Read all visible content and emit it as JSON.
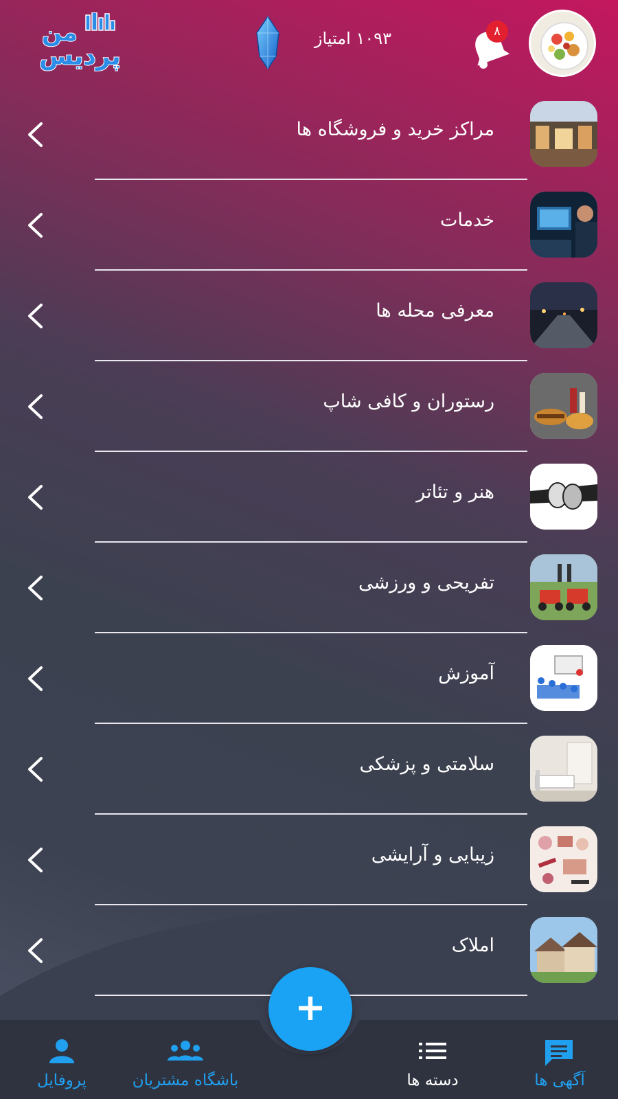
{
  "header": {
    "points_text": "۱۰۹۳ امتیاز",
    "notification_count": "۸",
    "logo_line1": "من",
    "logo_line2": "پردیس"
  },
  "categories": [
    {
      "label": "مراکز خرید و فروشگاه ها",
      "icon": "shopping-mall-thumbnail"
    },
    {
      "label": "خدمات",
      "icon": "services-thumbnail"
    },
    {
      "label": "معرفی محله ها",
      "icon": "neighborhood-thumbnail"
    },
    {
      "label": "رستوران و کافی شاپ",
      "icon": "restaurant-thumbnail"
    },
    {
      "label": "هنر و تئاتر",
      "icon": "theater-masks-thumbnail"
    },
    {
      "label": "تفریحی و ورزشی",
      "icon": "karting-thumbnail"
    },
    {
      "label": "آموزش",
      "icon": "classroom-thumbnail"
    },
    {
      "label": "سلامتی و پزشکی",
      "icon": "hospital-bed-thumbnail"
    },
    {
      "label": "زیبایی و آرایشی",
      "icon": "cosmetics-thumbnail"
    },
    {
      "label": "املاک",
      "icon": "houses-thumbnail"
    }
  ],
  "fab": {
    "label": "+"
  },
  "bottom_nav": [
    {
      "label": "آگهی ها",
      "icon": "ads-chat-icon",
      "active": true
    },
    {
      "label": "دسته ها",
      "icon": "list-icon",
      "active": false
    },
    {
      "label": "باشگاه مشتریان",
      "icon": "group-icon",
      "active": false
    },
    {
      "label": "پروفایل",
      "icon": "person-icon",
      "active": false
    }
  ],
  "colors": {
    "accent_blue": "#1aa3f5",
    "badge_red": "#e3202f",
    "gradient_top": "#c4175e",
    "nav_bg": "#2f3340"
  }
}
